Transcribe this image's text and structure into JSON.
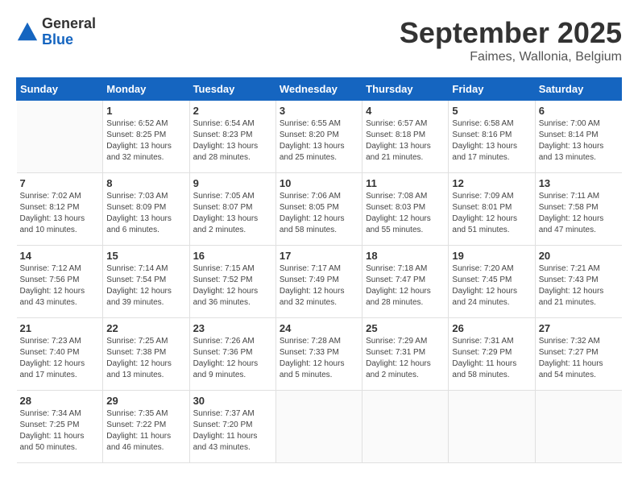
{
  "logo": {
    "general": "General",
    "blue": "Blue"
  },
  "title": "September 2025",
  "subtitle": "Faimes, Wallonia, Belgium",
  "days_of_week": [
    "Sunday",
    "Monday",
    "Tuesday",
    "Wednesday",
    "Thursday",
    "Friday",
    "Saturday"
  ],
  "weeks": [
    [
      {
        "day": "",
        "info": ""
      },
      {
        "day": "1",
        "info": "Sunrise: 6:52 AM\nSunset: 8:25 PM\nDaylight: 13 hours\nand 32 minutes."
      },
      {
        "day": "2",
        "info": "Sunrise: 6:54 AM\nSunset: 8:23 PM\nDaylight: 13 hours\nand 28 minutes."
      },
      {
        "day": "3",
        "info": "Sunrise: 6:55 AM\nSunset: 8:20 PM\nDaylight: 13 hours\nand 25 minutes."
      },
      {
        "day": "4",
        "info": "Sunrise: 6:57 AM\nSunset: 8:18 PM\nDaylight: 13 hours\nand 21 minutes."
      },
      {
        "day": "5",
        "info": "Sunrise: 6:58 AM\nSunset: 8:16 PM\nDaylight: 13 hours\nand 17 minutes."
      },
      {
        "day": "6",
        "info": "Sunrise: 7:00 AM\nSunset: 8:14 PM\nDaylight: 13 hours\nand 13 minutes."
      }
    ],
    [
      {
        "day": "7",
        "info": "Sunrise: 7:02 AM\nSunset: 8:12 PM\nDaylight: 13 hours\nand 10 minutes."
      },
      {
        "day": "8",
        "info": "Sunrise: 7:03 AM\nSunset: 8:09 PM\nDaylight: 13 hours\nand 6 minutes."
      },
      {
        "day": "9",
        "info": "Sunrise: 7:05 AM\nSunset: 8:07 PM\nDaylight: 13 hours\nand 2 minutes."
      },
      {
        "day": "10",
        "info": "Sunrise: 7:06 AM\nSunset: 8:05 PM\nDaylight: 12 hours\nand 58 minutes."
      },
      {
        "day": "11",
        "info": "Sunrise: 7:08 AM\nSunset: 8:03 PM\nDaylight: 12 hours\nand 55 minutes."
      },
      {
        "day": "12",
        "info": "Sunrise: 7:09 AM\nSunset: 8:01 PM\nDaylight: 12 hours\nand 51 minutes."
      },
      {
        "day": "13",
        "info": "Sunrise: 7:11 AM\nSunset: 7:58 PM\nDaylight: 12 hours\nand 47 minutes."
      }
    ],
    [
      {
        "day": "14",
        "info": "Sunrise: 7:12 AM\nSunset: 7:56 PM\nDaylight: 12 hours\nand 43 minutes."
      },
      {
        "day": "15",
        "info": "Sunrise: 7:14 AM\nSunset: 7:54 PM\nDaylight: 12 hours\nand 39 minutes."
      },
      {
        "day": "16",
        "info": "Sunrise: 7:15 AM\nSunset: 7:52 PM\nDaylight: 12 hours\nand 36 minutes."
      },
      {
        "day": "17",
        "info": "Sunrise: 7:17 AM\nSunset: 7:49 PM\nDaylight: 12 hours\nand 32 minutes."
      },
      {
        "day": "18",
        "info": "Sunrise: 7:18 AM\nSunset: 7:47 PM\nDaylight: 12 hours\nand 28 minutes."
      },
      {
        "day": "19",
        "info": "Sunrise: 7:20 AM\nSunset: 7:45 PM\nDaylight: 12 hours\nand 24 minutes."
      },
      {
        "day": "20",
        "info": "Sunrise: 7:21 AM\nSunset: 7:43 PM\nDaylight: 12 hours\nand 21 minutes."
      }
    ],
    [
      {
        "day": "21",
        "info": "Sunrise: 7:23 AM\nSunset: 7:40 PM\nDaylight: 12 hours\nand 17 minutes."
      },
      {
        "day": "22",
        "info": "Sunrise: 7:25 AM\nSunset: 7:38 PM\nDaylight: 12 hours\nand 13 minutes."
      },
      {
        "day": "23",
        "info": "Sunrise: 7:26 AM\nSunset: 7:36 PM\nDaylight: 12 hours\nand 9 minutes."
      },
      {
        "day": "24",
        "info": "Sunrise: 7:28 AM\nSunset: 7:33 PM\nDaylight: 12 hours\nand 5 minutes."
      },
      {
        "day": "25",
        "info": "Sunrise: 7:29 AM\nSunset: 7:31 PM\nDaylight: 12 hours\nand 2 minutes."
      },
      {
        "day": "26",
        "info": "Sunrise: 7:31 AM\nSunset: 7:29 PM\nDaylight: 11 hours\nand 58 minutes."
      },
      {
        "day": "27",
        "info": "Sunrise: 7:32 AM\nSunset: 7:27 PM\nDaylight: 11 hours\nand 54 minutes."
      }
    ],
    [
      {
        "day": "28",
        "info": "Sunrise: 7:34 AM\nSunset: 7:25 PM\nDaylight: 11 hours\nand 50 minutes."
      },
      {
        "day": "29",
        "info": "Sunrise: 7:35 AM\nSunset: 7:22 PM\nDaylight: 11 hours\nand 46 minutes."
      },
      {
        "day": "30",
        "info": "Sunrise: 7:37 AM\nSunset: 7:20 PM\nDaylight: 11 hours\nand 43 minutes."
      },
      {
        "day": "",
        "info": ""
      },
      {
        "day": "",
        "info": ""
      },
      {
        "day": "",
        "info": ""
      },
      {
        "day": "",
        "info": ""
      }
    ]
  ]
}
